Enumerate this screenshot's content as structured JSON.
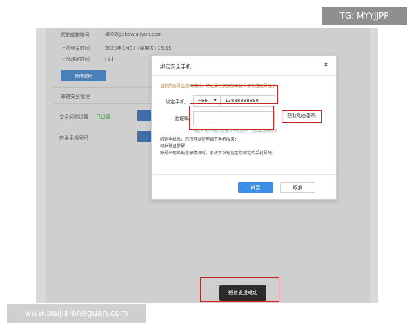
{
  "background": {
    "email_label": "您的邮箱账号",
    "email_value": "d002@show.aliyun.com",
    "last_login_label": "上次登录时间",
    "last_login_value": "2020年1月3日(星期五) 15:15",
    "last_change_label": "上次改密时间",
    "last_change_value": "[无]",
    "change_password_button": "修改密码",
    "section_title": "邮箱安全管理",
    "security_question_label": "安全问题设置",
    "security_question_status": "已设置",
    "security_phone_label": "安全手机号码"
  },
  "modal": {
    "title": "绑定安全手机",
    "close": "×",
    "tip": "当你的账号出现异常时，可以通过绑定的手机号来完成账号验证",
    "phone_label": "绑定手机：",
    "country_code": "+86",
    "phone_value": "13888888888",
    "code_label": "验证码：",
    "code_value": "",
    "get_code_button": "获取动态密码",
    "code_hint": "请在60秒内输入短信中的验证码，过期需重新获取",
    "after_bind_text": "绑定手机后，您将可以使用如下手机服务：",
    "service_name": "异地登录提醒",
    "service_desc": "账号出现异地登录情况时，系统下发短信至您绑定的手机号码。",
    "ok_button": "确定",
    "cancel_button": "取消"
  },
  "toast": {
    "message": "短信发送成功"
  },
  "watermarks": {
    "tg": "TG: MYYJJPP",
    "site": "www.baijialeheguan.com"
  },
  "colors": {
    "highlight_red": "#c62828",
    "primary_blue": "#3a8ee6"
  }
}
